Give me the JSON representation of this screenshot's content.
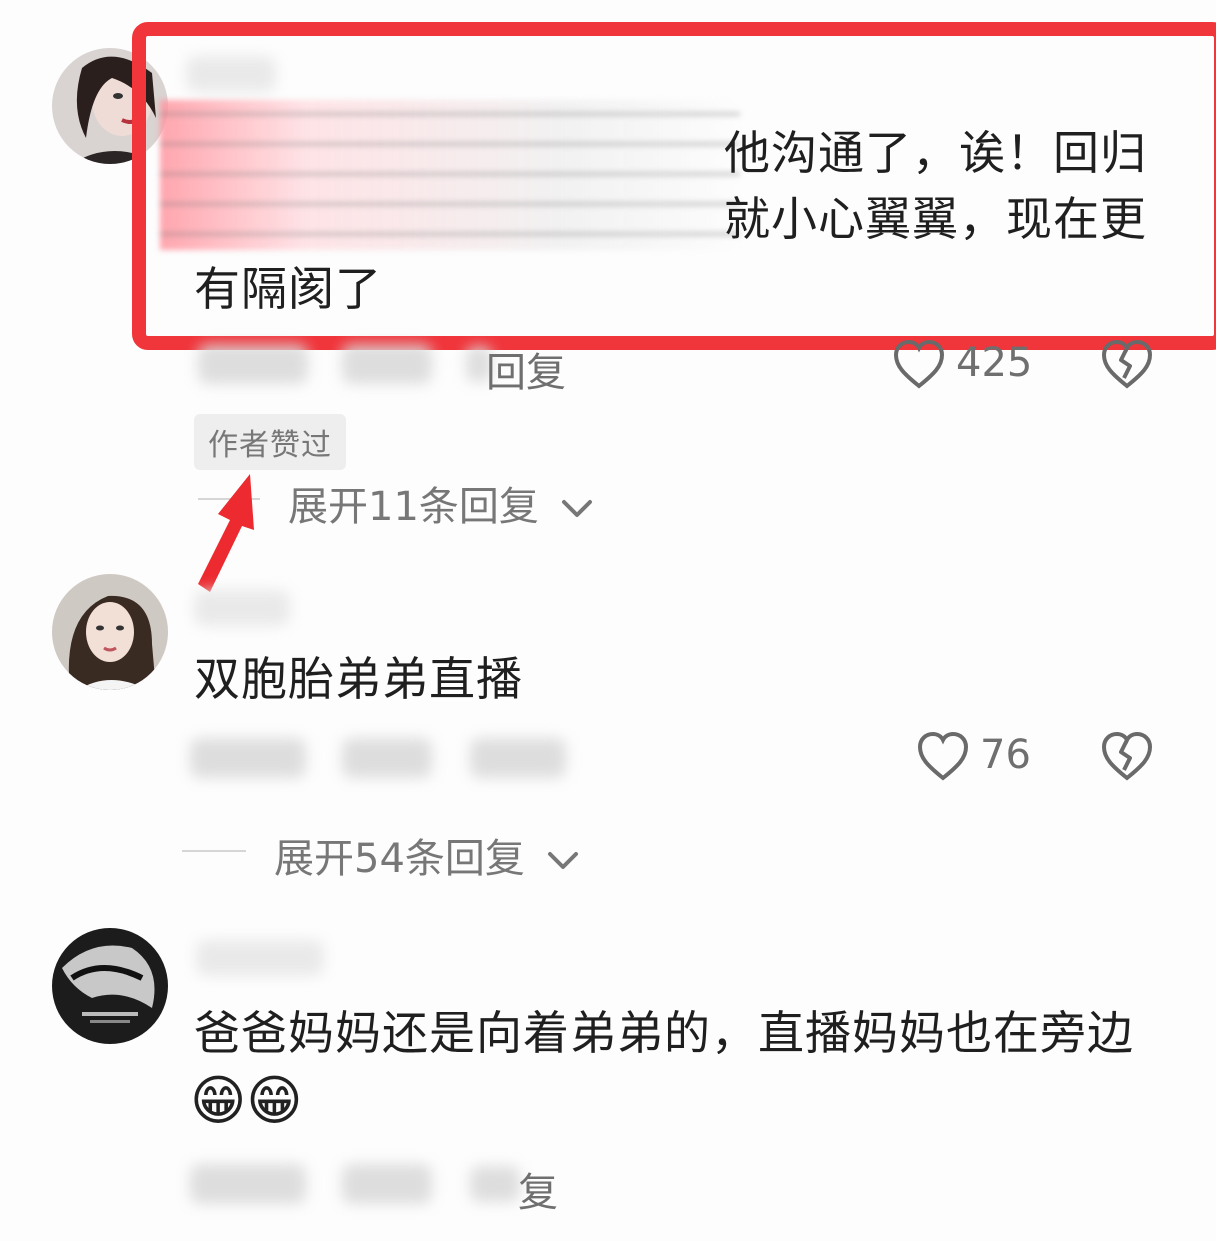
{
  "comments": [
    {
      "text_line1": "他沟通了，诶！回归",
      "text_line2": "就小心翼翼，现在更",
      "text_line3": "有隔阂了",
      "reply_label": "回复",
      "like_count": "425",
      "author_badge": "作者赞过",
      "expand_label": "展开11条回复"
    },
    {
      "text_line1": "双胞胎弟弟直播",
      "like_count": "76",
      "expand_label": "展开54条回复"
    },
    {
      "text_line1": "爸爸妈妈还是向着弟弟的，直播妈妈也在旁边",
      "emoji": "😁😁",
      "reply_label": "复"
    }
  ],
  "colors": {
    "highlight_red": "#f0353b",
    "text": "#1f1f1f",
    "muted": "#6f6f6f"
  },
  "icons": [
    "heart-outline-icon",
    "broken-heart-icon",
    "chevron-down-icon",
    "red-arrow"
  ]
}
